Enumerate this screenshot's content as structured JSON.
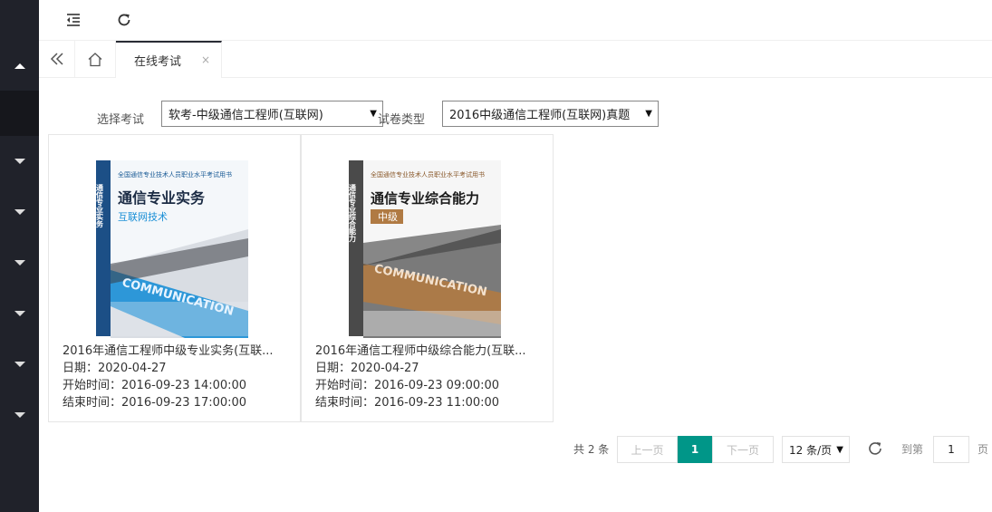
{
  "sidebar": {
    "items": [
      {
        "icon": "caret-up-icon"
      },
      {
        "icon": "none"
      },
      {
        "icon": "caret-down-icon"
      },
      {
        "icon": "caret-down-icon"
      },
      {
        "icon": "caret-down-icon"
      },
      {
        "icon": "caret-down-icon"
      },
      {
        "icon": "caret-down-icon"
      },
      {
        "icon": "caret-down-icon"
      }
    ]
  },
  "topbar": {
    "fold_icon": "menu-fold-icon",
    "refresh_icon": "refresh-icon"
  },
  "tabs": {
    "active_label": "在线考试",
    "close_glyph": "×"
  },
  "filters": {
    "exam_label": "选择考试",
    "exam_value": "软考-中级通信工程师(互联网)",
    "type_label": "试卷类型",
    "type_value": "2016中级通信工程师(互联网)真题"
  },
  "cards": [
    {
      "title": "2016年通信工程师中级专业实务(互联...",
      "date": "日期：2020-04-27",
      "start": "开始时间：2016-09-23 14:00:00",
      "end": "结束时间：2016-09-23 17:00:00",
      "cover": {
        "series": "全国通信专业技术人员职业水平考试用书",
        "main": "通信专业实务",
        "sub": "互联网技术",
        "band": "COMMUNICATION",
        "spine": "通信专业实务",
        "accent": "#1a8fd6"
      }
    },
    {
      "title": "2016年通信工程师中级综合能力(互联...",
      "date": "日期：2020-04-27",
      "start": "开始时间：2016-09-23 09:00:00",
      "end": "结束时间：2016-09-23 11:00:00",
      "cover": {
        "series": "全国通信专业技术人员职业水平考试用书",
        "main": "通信专业综合能力",
        "sub": "中级",
        "band": "COMMUNICATION",
        "spine": "通信专业综合能力",
        "accent": "#b07a43"
      }
    }
  ],
  "pagination": {
    "total": "共 2 条",
    "prev": "上一页",
    "current": "1",
    "next": "下一页",
    "page_size": "12 条/页",
    "goto_label": "到第",
    "goto_value": "1",
    "page_suffix": "页"
  },
  "colors": {
    "accent": "#009688",
    "sidebar": "#20222a"
  }
}
